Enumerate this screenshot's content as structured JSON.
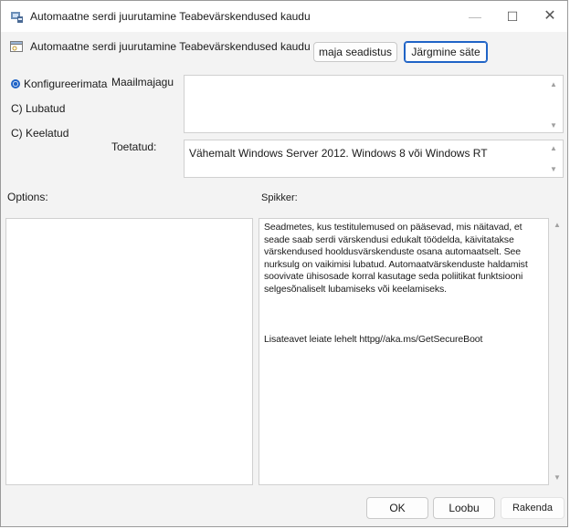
{
  "window": {
    "title": "Automaatne serdi juurutamine Teabevärskendused kaudu",
    "controls": {
      "minimize": "—",
      "maximize": "☐",
      "close": "✕"
    }
  },
  "header": {
    "policy_title": "Automaatne serdi juurutamine Teabevärskendused kaudu",
    "prev_button": "maja seadistus",
    "next_button": "Järgmine säte"
  },
  "state": {
    "options": [
      {
        "label": "Konfigureerimata",
        "selected": true
      },
      {
        "label": "C) Lubatud",
        "selected": false
      },
      {
        "label": "C) Keelatud",
        "selected": false
      }
    ]
  },
  "comment": {
    "label": "Maailmajagu",
    "value": ""
  },
  "supported": {
    "label": "Toetatud:",
    "value": "Vähemalt Windows Server 2012. Windows 8 või Windows RT"
  },
  "options_panel": {
    "label": "Options:"
  },
  "help_panel": {
    "label": "Spikker:",
    "text": "Seadmetes, kus testitulemused on pääsevad, mis näitavad, et seade saab serdi värskendusi edukalt töödelda, käivitatakse värskendused hooldusvärskenduste osana automaatselt. See nurksulg on vaikimisi lubatud. Automaatvärskenduste haldamist soovivate ühisosade korral kasutage seda poliitikat funktsiooni selgesõnaliselt lubamiseks või keelamiseks.",
    "link_text": "Lisateavet leiate lehelt httpg//aka.ms/GetSecureBoot"
  },
  "footer": {
    "ok": "OK",
    "cancel": "Loobu",
    "apply": "Rakenda"
  },
  "colors": {
    "accent": "#1f63c6",
    "window_bg": "#f3f3f3"
  }
}
